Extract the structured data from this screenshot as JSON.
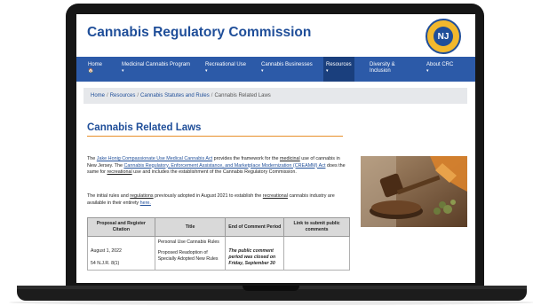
{
  "site": {
    "title": "Cannabis Regulatory Commission",
    "seal_glyph": "NJ"
  },
  "nav": [
    {
      "label": "Home",
      "sub": "🏠"
    },
    {
      "label": "Medicinal Cannabis Program",
      "sub": "▾"
    },
    {
      "label": "Recreational Use",
      "sub": "▾"
    },
    {
      "label": "Cannabis Businesses",
      "sub": "▾"
    },
    {
      "label": "Resources",
      "sub": "▾"
    },
    {
      "label": "Diversity &",
      "sub": "Inclusion"
    },
    {
      "label": "About CRC",
      "sub": "▾"
    }
  ],
  "breadcrumb": {
    "items": [
      "Home",
      "Resources",
      "Cannabis Statutes and Rules"
    ],
    "current": "Cannabis Related Laws",
    "separator": "/"
  },
  "page": {
    "heading": "Cannabis Related Laws",
    "para1": {
      "pre": "The ",
      "link1": "Jake Honig Compassionate Use Medical Cannabis Act",
      "mid1": " provides the framework for the ",
      "word1": "medicinal",
      "mid2": " use of cannabis in New Jersey. The ",
      "link2": "Cannabis Regulatory, Enforcement Assistance, and Marketplace Modernization (CREAMM) Act",
      "mid3": " does the same for ",
      "word2": "recreational",
      "post": " use and includes the establishment of the Cannabis Regulatory Commission."
    },
    "para2": {
      "pre": "The initial rules and ",
      "word1": "regulations",
      "mid": " previously adopted in August 2021 to establish the ",
      "word2": "recreational",
      "post": " cannabis industry are available in their entirety ",
      "link": "here."
    }
  },
  "table": {
    "headers": [
      "Proposal and Register Citation",
      "Title",
      "End of Comment Period",
      "Link to submit public comments"
    ],
    "rows": [
      {
        "citation_date": "August 1, 2022",
        "citation_reg": "54 N.J.R. 8(1)",
        "title_1": "Personal Use Cannabis Rules",
        "title_2": "Proposed Readoption of Specially Adopted New Rules",
        "comment_period": "The public comment period was closed on Friday, September 30",
        "comment_link": ""
      }
    ]
  },
  "colors": {
    "brand_blue": "#1f4e99",
    "nav_blue": "#2c5aa8",
    "accent_orange": "#e8902a",
    "seal_gold": "#f1b82d"
  }
}
